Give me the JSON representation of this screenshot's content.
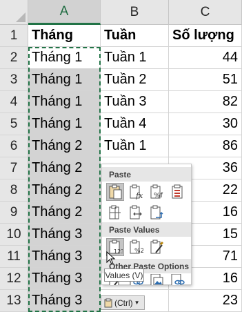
{
  "columns": [
    "A",
    "B",
    "C"
  ],
  "rows": [
    "1",
    "2",
    "3",
    "4",
    "5",
    "6",
    "7",
    "8",
    "9",
    "10",
    "11",
    "12",
    "13"
  ],
  "headers": {
    "a": "Tháng",
    "b": "Tuần",
    "c": "Số lượng"
  },
  "data": [
    {
      "a": "Tháng 1",
      "b": "Tuần 1",
      "c": "44"
    },
    {
      "a": "Tháng 1",
      "b": "Tuần 2",
      "c": "51"
    },
    {
      "a": "Tháng 1",
      "b": "Tuần 3",
      "c": "82"
    },
    {
      "a": "Tháng 1",
      "b": "Tuần 4",
      "c": "30"
    },
    {
      "a": "Tháng 2",
      "b": "Tuần 1",
      "c": "86"
    },
    {
      "a": "Tháng 2",
      "b": "",
      "c": "36"
    },
    {
      "a": "Tháng 2",
      "b": "",
      "c": "22"
    },
    {
      "a": "Tháng 2",
      "b": "",
      "c": "16"
    },
    {
      "a": "Tháng 3",
      "b": "",
      "c": "15"
    },
    {
      "a": "Tháng 3",
      "b": "",
      "c": "71"
    },
    {
      "a": "Tháng 3",
      "b": "",
      "c": "16"
    },
    {
      "a": "Tháng 3",
      "b": "",
      "c": "23"
    }
  ],
  "paste_menu": {
    "paste_label": "Paste",
    "paste_values_label": "Paste Values",
    "other_label": "Other Paste Options",
    "tooltip": "Values (V)",
    "ctrl_label": "(Ctrl)",
    "paste_icons": [
      "paste-icon",
      "paste-formulas-icon",
      "paste-formulas-number-format-icon",
      "keep-source-formatting-icon",
      "no-borders-icon",
      "keep-column-widths-icon",
      "transpose-icon"
    ],
    "value_icons": [
      "values-icon",
      "values-number-format-icon",
      "values-source-formatting-icon"
    ],
    "other_icons": [
      "formatting-icon",
      "paste-link-icon",
      "picture-icon",
      "linked-picture-icon"
    ]
  },
  "colors": {
    "accent": "#217346",
    "selection": "#d3d3d3",
    "header": "#e6e6e6"
  }
}
